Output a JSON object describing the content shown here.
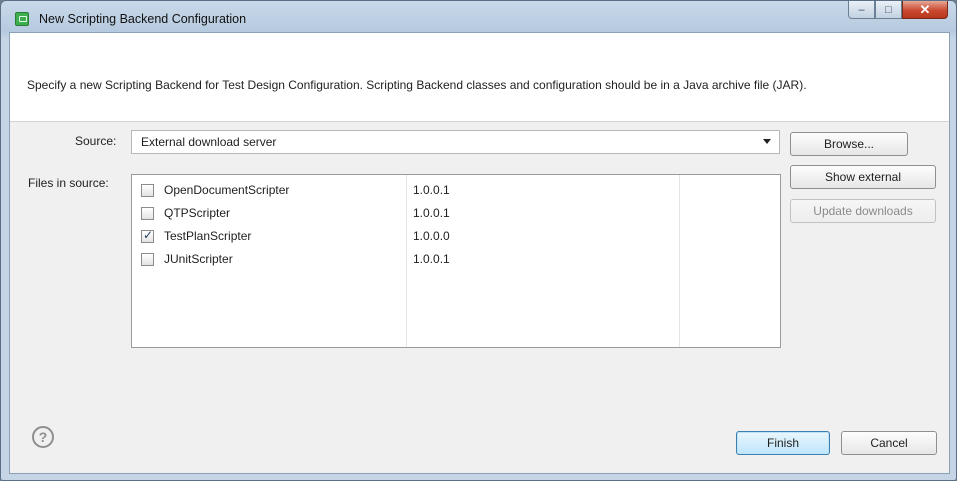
{
  "window": {
    "title": "New Scripting Backend Configuration",
    "description": "Specify a new Scripting Backend for Test Design Configuration. Scripting Backend classes and configuration should be in a Java archive file (JAR).",
    "controls": {
      "minimize": "–",
      "maximize": "□",
      "close": "✕"
    }
  },
  "source": {
    "label": "Source:",
    "value": "External download server"
  },
  "files": {
    "label": "Files in source:",
    "rows": [
      {
        "name": "OpenDocumentScripter",
        "version": "1.0.0.1",
        "checked": false
      },
      {
        "name": "QTPScripter",
        "version": "1.0.0.1",
        "checked": false
      },
      {
        "name": "TestPlanScripter",
        "version": "1.0.0.0",
        "checked": true
      },
      {
        "name": "JUnitScripter",
        "version": "1.0.0.1",
        "checked": false
      }
    ]
  },
  "buttons": {
    "browse": "Browse...",
    "show_external": "Show external",
    "update_downloads": "Update downloads",
    "finish": "Finish",
    "cancel": "Cancel",
    "help": "?"
  },
  "icons": {
    "app": "app-icon",
    "help": "help-icon",
    "dropdown": "chevron-down-icon"
  }
}
